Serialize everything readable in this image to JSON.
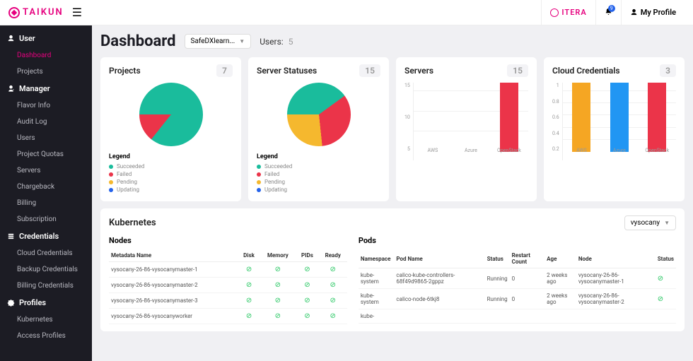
{
  "brand": "TAIKUN",
  "header": {
    "partner": "ITERA",
    "notif_count": "9",
    "profile": "My Profile"
  },
  "sidebar": {
    "sections": [
      {
        "label": "User",
        "items": [
          "Dashboard",
          "Projects"
        ],
        "active": 0
      },
      {
        "label": "Manager",
        "items": [
          "Flavor Info",
          "Audit Log",
          "Users",
          "Project Quotas",
          "Servers",
          "Chargeback",
          "Billing",
          "Subscription"
        ]
      },
      {
        "label": "Credentials",
        "items": [
          "Cloud Credentials",
          "Backup Credentials",
          "Billing Credentials"
        ]
      },
      {
        "label": "Profiles",
        "items": [
          "Kubernetes",
          "Access Profiles"
        ]
      }
    ]
  },
  "page": {
    "title": "Dashboard",
    "org_selector": "SafeDXlearn...",
    "users_label": "Users:",
    "users_count": "5"
  },
  "cards": {
    "projects": {
      "title": "Projects",
      "count": "7"
    },
    "statuses": {
      "title": "Server Statuses",
      "count": "15"
    },
    "servers": {
      "title": "Servers",
      "count": "15"
    },
    "cloud": {
      "title": "Cloud Credentials",
      "count": "3"
    }
  },
  "legend": {
    "title": "Legend",
    "items": [
      "Succeeded",
      "Failed",
      "Pending",
      "Updating"
    ]
  },
  "legend_colors": [
    "#1abc9c",
    "#eb3449",
    "#f5b82e",
    "#2563eb"
  ],
  "chart_data": [
    {
      "type": "pie",
      "title": "Projects",
      "series": [
        {
          "name": "Succeeded",
          "value": 6,
          "color": "#1abc9c"
        },
        {
          "name": "Failed",
          "value": 1,
          "color": "#eb3449"
        }
      ],
      "total": 7
    },
    {
      "type": "pie",
      "title": "Server Statuses",
      "series": [
        {
          "name": "Succeeded",
          "value": 6,
          "color": "#1abc9c"
        },
        {
          "name": "Failed",
          "value": 5,
          "color": "#eb3449"
        },
        {
          "name": "Pending",
          "value": 4,
          "color": "#f5b82e"
        }
      ],
      "total": 15
    },
    {
      "type": "bar",
      "title": "Servers",
      "categories": [
        "AWS",
        "Azure",
        "OpenStack"
      ],
      "values": [
        0,
        0,
        15
      ],
      "ylim": [
        0,
        15
      ],
      "yticks": [
        5,
        10,
        15
      ],
      "color": "#eb3449"
    },
    {
      "type": "bar",
      "title": "Cloud Credentials",
      "categories": [
        "AWS",
        "Azure",
        "OpenStack"
      ],
      "values": [
        1,
        1,
        1
      ],
      "ylim": [
        0,
        1
      ],
      "yticks": [
        0.2,
        0.4,
        0.6,
        0.8,
        1.0
      ],
      "colors": [
        "#f5a623",
        "#2196f3",
        "#eb3449"
      ]
    }
  ],
  "kube": {
    "title": "Kubernetes",
    "selector": "vysocany",
    "nodes": {
      "title": "Nodes",
      "headers": [
        "Metadata Name",
        "Disk",
        "Memory",
        "PIDs",
        "Ready"
      ],
      "rows": [
        "vysocany-26-86-vysocanymaster-1",
        "vysocany-26-86-vysocanymaster-2",
        "vysocany-26-86-vysocanymaster-3",
        "vysocany-26-86-vysocanyworker"
      ]
    },
    "pods": {
      "title": "Pods",
      "headers": [
        "Namespace",
        "Pod Name",
        "Status",
        "Restart Count",
        "Age",
        "Node",
        "Status"
      ],
      "rows": [
        {
          "ns": "kube-system",
          "name": "calico-kube-controllers-68f49d9865-2gppz",
          "status": "Running",
          "restart": "0",
          "age": "2 weeks ago",
          "node": "vysocany-26-86-vysocanymaster-1"
        },
        {
          "ns": "kube-system",
          "name": "calico-node-6tkj8",
          "status": "Running",
          "restart": "0",
          "age": "2 weeks ago",
          "node": "vysocany-26-86-vysocanymaster-2"
        },
        {
          "ns": "kube-",
          "name": "",
          "status": "",
          "restart": "",
          "age": "",
          "node": ""
        }
      ]
    }
  }
}
